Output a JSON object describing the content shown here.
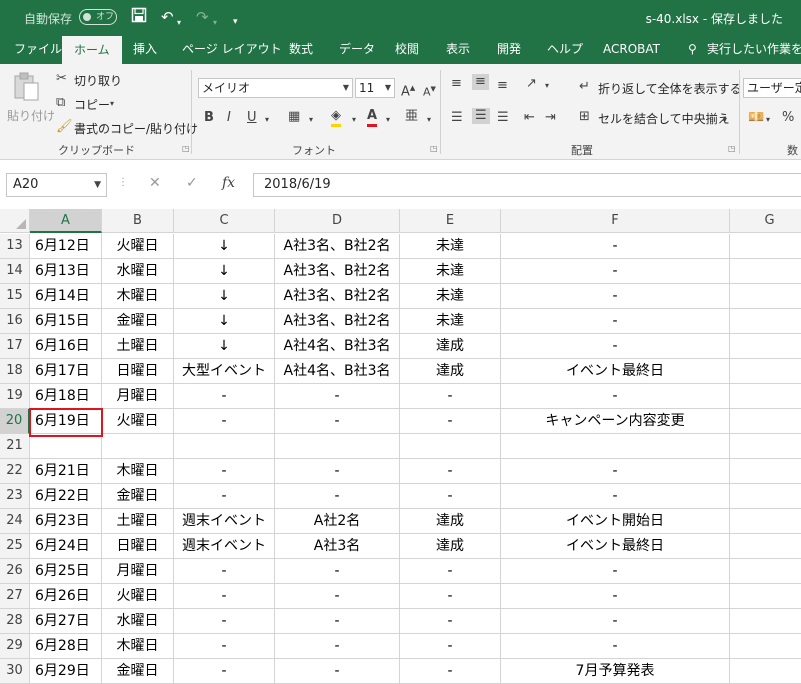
{
  "titlebar": {
    "autosave_label": "自動保存",
    "autosave_state": "オフ",
    "title": "s-40.xlsx  -  保存しました",
    "bg_color": "#217346"
  },
  "tabs": [
    "ファイル",
    "ホーム",
    "挿入",
    "ページ レイアウト",
    "数式",
    "データ",
    "校閲",
    "表示",
    "開発",
    "ヘルプ",
    "ACROBAT",
    "実行したい作業を入"
  ],
  "active_tab": "ホーム",
  "ribbon": {
    "clipboard": {
      "paste": "貼り付け",
      "cut": "切り取り",
      "copy": "コピー",
      "format_painter": "書式のコピー/貼り付け",
      "label": "クリップボード"
    },
    "font": {
      "name": "メイリオ",
      "size": "11",
      "label": "フォント"
    },
    "alignment": {
      "wrap": "折り返して全体を表示する",
      "merge": "セルを結合して中央揃え",
      "label": "配置"
    },
    "number": {
      "format": "ユーザー定義",
      "label": "数"
    }
  },
  "formula_bar": {
    "name_box": "A20",
    "formula": "2018/6/19"
  },
  "columns": [
    "A",
    "B",
    "C",
    "D",
    "E",
    "F",
    "G"
  ],
  "selected_cell": "A20",
  "rows": [
    {
      "num": "13",
      "cells": [
        "6月12日",
        "火曜日",
        "↓",
        "A社3名、B社2名",
        "未達",
        "-"
      ]
    },
    {
      "num": "14",
      "cells": [
        "6月13日",
        "水曜日",
        "↓",
        "A社3名、B社2名",
        "未達",
        "-"
      ]
    },
    {
      "num": "15",
      "cells": [
        "6月14日",
        "木曜日",
        "↓",
        "A社3名、B社2名",
        "未達",
        "-"
      ]
    },
    {
      "num": "16",
      "cells": [
        "6月15日",
        "金曜日",
        "↓",
        "A社3名、B社2名",
        "未達",
        "-"
      ]
    },
    {
      "num": "17",
      "cells": [
        "6月16日",
        "土曜日",
        "↓",
        "A社4名、B社3名",
        "達成",
        "-"
      ]
    },
    {
      "num": "18",
      "cells": [
        "6月17日",
        "日曜日",
        "大型イベント",
        "A社4名、B社3名",
        "達成",
        "イベント最終日"
      ]
    },
    {
      "num": "19",
      "cells": [
        "6月18日",
        "月曜日",
        "-",
        "-",
        "-",
        "-"
      ]
    },
    {
      "num": "20",
      "cells": [
        "6月19日",
        "火曜日",
        "-",
        "-",
        "-",
        "キャンペーン内容変更"
      ]
    },
    {
      "num": "21",
      "cells": [
        "",
        "",
        "",
        "",
        "",
        ""
      ]
    },
    {
      "num": "22",
      "cells": [
        "6月21日",
        "木曜日",
        "-",
        "-",
        "-",
        "-"
      ]
    },
    {
      "num": "23",
      "cells": [
        "6月22日",
        "金曜日",
        "-",
        "-",
        "-",
        "-"
      ]
    },
    {
      "num": "24",
      "cells": [
        "6月23日",
        "土曜日",
        "週末イベント",
        "A社2名",
        "達成",
        "イベント開始日"
      ]
    },
    {
      "num": "25",
      "cells": [
        "6月24日",
        "日曜日",
        "週末イベント",
        "A社3名",
        "達成",
        "イベント最終日"
      ]
    },
    {
      "num": "26",
      "cells": [
        "6月25日",
        "月曜日",
        "-",
        "-",
        "-",
        "-"
      ]
    },
    {
      "num": "27",
      "cells": [
        "6月26日",
        "火曜日",
        "-",
        "-",
        "-",
        "-"
      ]
    },
    {
      "num": "28",
      "cells": [
        "6月27日",
        "水曜日",
        "-",
        "-",
        "-",
        "-"
      ]
    },
    {
      "num": "29",
      "cells": [
        "6月28日",
        "木曜日",
        "-",
        "-",
        "-",
        "-"
      ]
    },
    {
      "num": "30",
      "cells": [
        "6月29日",
        "金曜日",
        "-",
        "-",
        "-",
        "7月予算発表"
      ]
    }
  ]
}
